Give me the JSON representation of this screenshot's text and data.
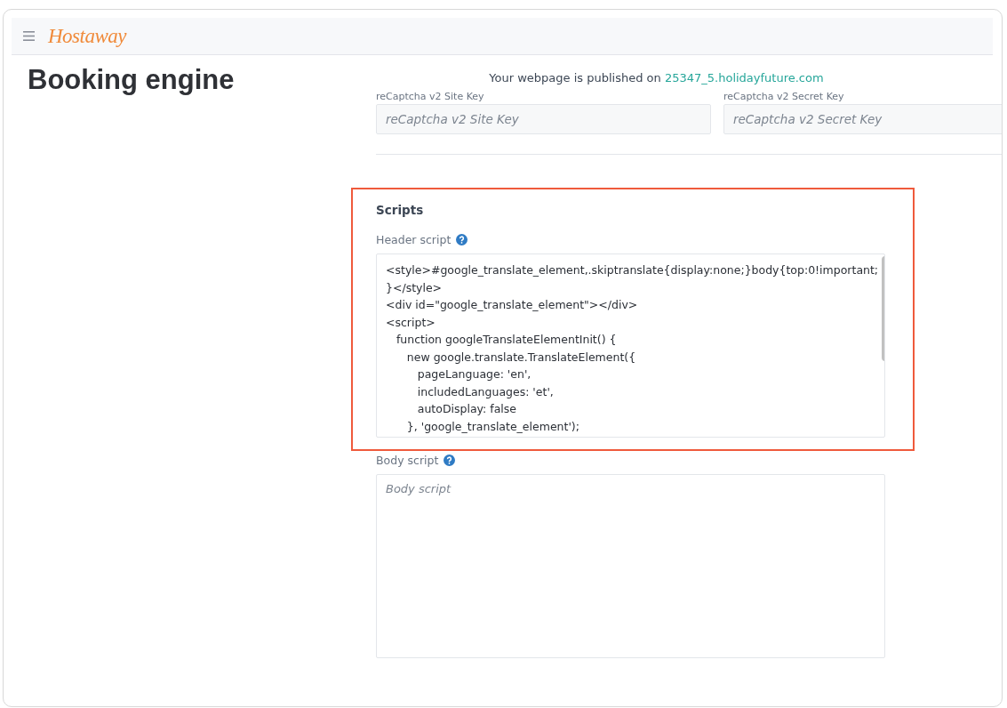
{
  "header": {
    "logo": "Hostaway"
  },
  "page": {
    "title": "Booking engine"
  },
  "published": {
    "text": "Your webpage is published on",
    "link": "25347_5.holidayfuture.com"
  },
  "recaptcha_fields": [
    {
      "label": "reCaptcha v2 Site Key",
      "placeholder": "reCaptcha v2 Site Key"
    },
    {
      "label": "reCaptcha v2 Secret Key",
      "placeholder": "reCaptcha v2 Secret Key"
    }
  ],
  "scripts": {
    "title": "Scripts",
    "highlighted": true,
    "fields": [
      {
        "label": "Header script",
        "lines": [
          "<style>#google_translate_element,.skiptranslate{display:none;}body{top:0!important;",
          "}</style>",
          "<div id=\"google_translate_element\"></div>",
          "<script>",
          "   function googleTranslateElementInit() {",
          "      new google.translate.TranslateElement({",
          "         pageLanguage: 'en',",
          "         includedLanguages: 'et',",
          "         autoDisplay: false",
          "      }, 'google_translate_element');"
        ]
      },
      {
        "label": "Body script",
        "placeholder": "Body script"
      }
    ]
  }
}
